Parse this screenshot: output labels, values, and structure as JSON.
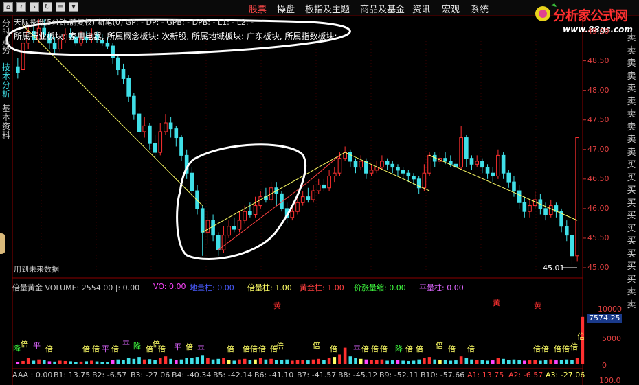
{
  "toolbar": {
    "nav_icons": [
      "home-icon",
      "back-icon",
      "forward-icon",
      "refresh-icon",
      "list-icon",
      "dropdown-icon"
    ],
    "menu": [
      "股票",
      "操盘",
      "板指及主题",
      "商品及基金",
      "资讯",
      "宏观",
      "系统"
    ],
    "active_menu": "股票"
  },
  "logo": {
    "title": "分析家公式网",
    "url": "www.88gs.com"
  },
  "left_tabs": [
    "分时走势",
    "技术分析",
    "基本资料"
  ],
  "chart_header": "天际股份(5分钟,前复权) 新笔(0)  GP: -  DP: -  GPB: -  DPB: -  L1: -  L2: -",
  "info_line": "所属行业板块: 家用电器, 所属概念板块: 次新股, 所属地域板块: 广东板块, 所属指数板块:",
  "footnote": "用到未来数据",
  "low_marker": "45.01",
  "price_axis": [
    "49.00",
    "48.50",
    "48.00",
    "47.50",
    "47.00",
    "46.50",
    "46.00",
    "45.50",
    "45.00"
  ],
  "vol_axis": [
    "10000",
    "5000",
    "0",
    "100.0"
  ],
  "vol_current": "7574.25",
  "volume_header": [
    {
      "text": "倍量黄金  VOLUME: 2554.00  |: 0.00",
      "color": "#c8c8c8"
    },
    {
      "text": "VO: 0.00",
      "color": "#ff44ff"
    },
    {
      "text": "地量柱: 0.00",
      "color": "#4a5cff"
    },
    {
      "text": "倍量柱: 1.00",
      "color": "#ffff66"
    },
    {
      "text": "黄金柱: 1.00",
      "color": "#ff4040"
    },
    {
      "text": "价涨量缩: 0.00",
      "color": "#40ff40"
    },
    {
      "text": "平量柱: 0.00",
      "color": "#dd66ff"
    }
  ],
  "bottom_line": [
    {
      "text": "AAA : 0.00",
      "color": "#c8c8c8"
    },
    {
      "text": "B1: 13.75",
      "color": "#c8c8c8"
    },
    {
      "text": "B2: -6.57",
      "color": "#c8c8c8"
    },
    {
      "text": "B3: -27.06",
      "color": "#c8c8c8"
    },
    {
      "text": "B4: -40.34",
      "color": "#c8c8c8"
    },
    {
      "text": "B5: -42.14",
      "color": "#c8c8c8"
    },
    {
      "text": "B6: -41.10",
      "color": "#c8c8c8"
    },
    {
      "text": "B7: -41.57",
      "color": "#c8c8c8"
    },
    {
      "text": "B8: -45.12",
      "color": "#c8c8c8"
    },
    {
      "text": "B9: -52.11",
      "color": "#c8c8c8"
    },
    {
      "text": "B10: -57.66",
      "color": "#c8c8c8"
    },
    {
      "text": "A1: 13.75",
      "color": "#ff4040"
    },
    {
      "text": "A2: -6.57",
      "color": "#ff4040"
    },
    {
      "text": "A3: -27.06",
      "color": "#ffff66"
    }
  ],
  "side_labels": [
    "卖",
    "卖",
    "卖",
    "卖",
    "卖",
    "卖",
    "卖",
    "卖",
    "卖",
    "卖",
    "买",
    "买",
    "买",
    "买",
    "买",
    "买",
    "买",
    "买",
    "买",
    "买",
    "卖",
    "卖"
  ],
  "vol_labels": {
    "huang": "黄",
    "bei": "倍",
    "ping": "平",
    "jiang": "降"
  },
  "colors": {
    "up": "#ff3030",
    "down": "#40e0e8",
    "trend": "#ffff66",
    "axis": "#8b0000",
    "highlight": "#ffffff"
  },
  "chart_data": {
    "type": "candlestick",
    "price_range": [
      45.0,
      49.25
    ],
    "vol_range": [
      0,
      10000
    ],
    "candles": [
      [
        48.4,
        48.3,
        48.55,
        48.2
      ],
      [
        48.35,
        48.8,
        48.95,
        48.3
      ],
      [
        48.8,
        49.0,
        49.1,
        48.7
      ],
      [
        49.0,
        48.85,
        49.15,
        48.8
      ],
      [
        48.85,
        49.05,
        49.2,
        48.8
      ],
      [
        49.05,
        48.95,
        49.2,
        48.9
      ],
      [
        48.95,
        48.8,
        49.0,
        48.7
      ],
      [
        48.8,
        48.7,
        48.9,
        48.6
      ],
      [
        48.7,
        48.85,
        48.95,
        48.65
      ],
      [
        48.85,
        48.95,
        49.05,
        48.8
      ],
      [
        48.95,
        48.9,
        49.05,
        48.85
      ],
      [
        48.9,
        48.8,
        48.95,
        48.75
      ],
      [
        48.8,
        48.9,
        49.0,
        48.75
      ],
      [
        48.9,
        48.85,
        49.0,
        48.8
      ],
      [
        48.85,
        48.95,
        49.05,
        48.8
      ],
      [
        48.95,
        48.85,
        49.0,
        48.8
      ],
      [
        48.85,
        48.8,
        48.95,
        48.75
      ],
      [
        48.8,
        48.75,
        48.9,
        48.7
      ],
      [
        48.75,
        48.55,
        48.8,
        48.45
      ],
      [
        48.55,
        48.35,
        48.6,
        48.25
      ],
      [
        48.35,
        48.2,
        48.45,
        48.1
      ],
      [
        48.2,
        47.9,
        48.25,
        47.8
      ],
      [
        47.9,
        47.6,
        47.95,
        47.5
      ],
      [
        47.6,
        47.3,
        47.7,
        47.2
      ],
      [
        47.3,
        47.4,
        47.55,
        47.2
      ],
      [
        47.4,
        47.1,
        47.45,
        47.0
      ],
      [
        47.1,
        46.95,
        47.25,
        46.85
      ],
      [
        46.95,
        47.3,
        47.45,
        46.9
      ],
      [
        47.3,
        47.45,
        47.6,
        47.25
      ],
      [
        47.45,
        47.35,
        47.55,
        47.2
      ],
      [
        47.35,
        47.2,
        47.4,
        47.05
      ],
      [
        47.2,
        46.9,
        47.25,
        46.8
      ],
      [
        46.9,
        46.6,
        47.0,
        46.5
      ],
      [
        46.6,
        46.3,
        46.7,
        46.2
      ],
      [
        46.3,
        46.0,
        46.4,
        45.9
      ],
      [
        46.0,
        45.6,
        46.05,
        45.2
      ],
      [
        45.6,
        45.8,
        45.95,
        45.4
      ],
      [
        45.8,
        45.55,
        45.9,
        45.45
      ],
      [
        45.55,
        45.3,
        45.6,
        45.2
      ],
      [
        45.3,
        45.55,
        45.7,
        45.25
      ],
      [
        45.55,
        45.7,
        45.8,
        45.5
      ],
      [
        45.7,
        45.65,
        45.85,
        45.6
      ],
      [
        45.65,
        45.8,
        45.95,
        45.6
      ],
      [
        45.8,
        45.95,
        46.05,
        45.75
      ],
      [
        45.95,
        45.9,
        46.1,
        45.85
      ],
      [
        45.9,
        46.05,
        46.2,
        45.85
      ],
      [
        46.05,
        46.2,
        46.3,
        46.0
      ],
      [
        46.2,
        46.15,
        46.35,
        46.1
      ],
      [
        46.15,
        46.35,
        46.45,
        46.1
      ],
      [
        46.35,
        46.25,
        46.45,
        46.05
      ],
      [
        46.25,
        46.0,
        46.3,
        45.95
      ],
      [
        46.0,
        45.85,
        46.1,
        45.75
      ],
      [
        45.85,
        45.95,
        46.05,
        45.8
      ],
      [
        45.95,
        46.1,
        46.2,
        45.9
      ],
      [
        46.1,
        46.2,
        46.3,
        46.05
      ],
      [
        46.2,
        46.15,
        46.35,
        46.1
      ],
      [
        46.15,
        46.3,
        46.4,
        46.1
      ],
      [
        46.3,
        46.4,
        46.5,
        46.25
      ],
      [
        46.4,
        46.35,
        46.5,
        46.3
      ],
      [
        46.35,
        46.55,
        46.65,
        46.3
      ],
      [
        46.55,
        46.6,
        46.7,
        46.45
      ],
      [
        46.6,
        46.85,
        46.95,
        46.55
      ],
      [
        46.85,
        46.95,
        47.05,
        46.8
      ],
      [
        46.95,
        46.8,
        47.0,
        46.7
      ],
      [
        46.8,
        46.7,
        46.85,
        46.6
      ],
      [
        46.7,
        46.8,
        46.9,
        46.65
      ],
      [
        46.8,
        46.6,
        46.85,
        46.5
      ],
      [
        46.6,
        46.65,
        46.75,
        46.55
      ],
      [
        46.65,
        46.7,
        46.8,
        46.6
      ],
      [
        46.7,
        46.8,
        46.9,
        46.65
      ],
      [
        46.8,
        46.75,
        46.85,
        46.65
      ],
      [
        46.75,
        46.7,
        46.8,
        46.6
      ],
      [
        46.7,
        46.65,
        46.75,
        46.55
      ],
      [
        46.65,
        46.6,
        46.7,
        46.5
      ],
      [
        46.6,
        46.55,
        46.65,
        46.45
      ],
      [
        46.55,
        46.5,
        46.6,
        46.4
      ],
      [
        46.5,
        46.35,
        46.55,
        46.25
      ],
      [
        46.35,
        46.6,
        46.75,
        46.3
      ],
      [
        46.6,
        46.9,
        46.95,
        46.55
      ],
      [
        46.9,
        46.8,
        46.95,
        46.7
      ],
      [
        46.8,
        46.85,
        46.95,
        46.75
      ],
      [
        46.85,
        46.8,
        46.95,
        46.75
      ],
      [
        46.8,
        46.75,
        46.9,
        46.7
      ],
      [
        46.75,
        46.7,
        46.85,
        46.65
      ],
      [
        46.7,
        47.2,
        47.4,
        46.65
      ],
      [
        47.2,
        46.85,
        47.25,
        46.7
      ],
      [
        46.85,
        46.75,
        46.9,
        46.65
      ],
      [
        46.75,
        46.8,
        46.9,
        46.7
      ],
      [
        46.8,
        46.7,
        46.85,
        46.6
      ],
      [
        46.7,
        46.6,
        46.75,
        46.5
      ],
      [
        46.6,
        46.55,
        46.7,
        46.45
      ],
      [
        46.55,
        46.9,
        47.0,
        46.5
      ],
      [
        46.9,
        46.6,
        46.95,
        46.5
      ],
      [
        46.6,
        46.45,
        46.65,
        46.35
      ],
      [
        46.45,
        46.3,
        46.55,
        46.2
      ],
      [
        46.3,
        46.1,
        46.4,
        46.0
      ],
      [
        46.1,
        45.95,
        46.2,
        45.85
      ],
      [
        45.95,
        46.05,
        46.15,
        45.85
      ],
      [
        46.05,
        46.15,
        46.3,
        46.0
      ],
      [
        46.15,
        46.0,
        46.25,
        45.9
      ],
      [
        46.0,
        45.9,
        46.1,
        45.8
      ],
      [
        45.9,
        46.05,
        46.15,
        45.85
      ],
      [
        46.05,
        45.95,
        46.1,
        45.85
      ],
      [
        45.95,
        45.7,
        46.0,
        45.6
      ],
      [
        45.7,
        45.55,
        45.8,
        45.45
      ],
      [
        45.55,
        45.2,
        45.6,
        45.05
      ],
      [
        45.2,
        47.2,
        47.2,
        45.1
      ]
    ],
    "volume": [
      300,
      450,
      900,
      500,
      700,
      600,
      400,
      350,
      500,
      450,
      400,
      300,
      350,
      400,
      500,
      380,
      300,
      250,
      600,
      700,
      650,
      900,
      800,
      1100,
      700,
      750,
      600,
      900,
      1200,
      800,
      600,
      700,
      900,
      1000,
      1100,
      1300,
      900,
      700,
      800,
      900,
      600,
      500,
      700,
      800,
      650,
      700,
      900,
      700,
      800,
      650,
      600,
      700,
      500,
      600,
      650,
      550,
      700,
      800,
      600,
      900,
      1100,
      1500,
      2600,
      1200,
      900,
      800,
      700,
      600,
      650,
      700,
      500,
      550,
      600,
      500,
      450,
      500,
      700,
      900,
      1100,
      700,
      600,
      650,
      500,
      550,
      1200,
      900,
      700,
      600,
      650,
      500,
      550,
      900,
      800,
      600,
      700,
      650,
      500,
      550,
      600,
      500,
      600,
      700,
      550,
      600,
      700,
      650,
      900,
      7574
    ],
    "trend_lines": [
      [
        1,
        49.1,
        35,
        46.05
      ],
      [
        35,
        45.6,
        62,
        46.95
      ],
      [
        62,
        46.95,
        78,
        46.3
      ],
      [
        78,
        46.9,
        106,
        45.8
      ]
    ],
    "red_trend": [
      [
        38,
        45.3,
        55,
        46.45
      ],
      [
        55,
        46.45,
        61,
        46.9
      ]
    ]
  }
}
